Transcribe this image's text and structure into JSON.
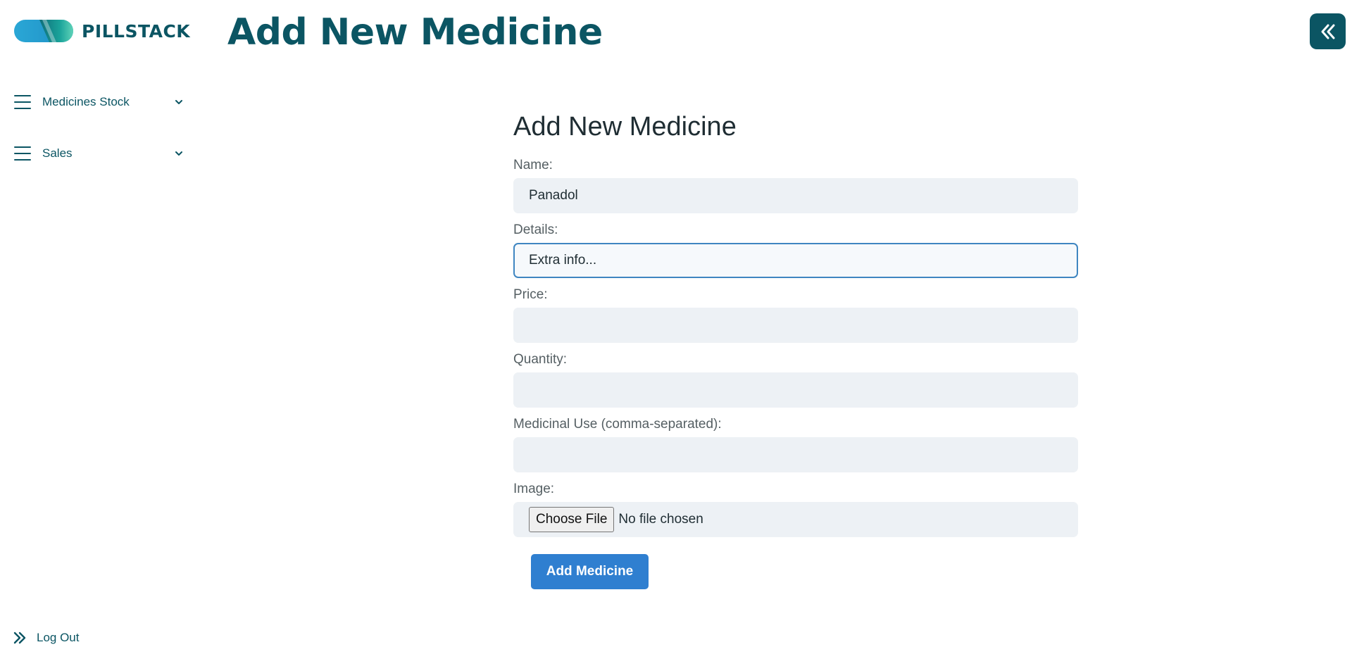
{
  "brand": {
    "name": "PILLSTACK"
  },
  "header": {
    "title": "Add New Medicine"
  },
  "sidebar": {
    "items": [
      {
        "label": "Medicines Stock",
        "icon": "menu-icon"
      },
      {
        "label": "Sales",
        "icon": "menu-icon"
      }
    ],
    "logout_label": "Log Out"
  },
  "form": {
    "title": "Add New Medicine",
    "fields": {
      "name": {
        "label": "Name:",
        "value": "Panadol"
      },
      "details": {
        "label": "Details:",
        "value": "Extra info..."
      },
      "price": {
        "label": "Price:",
        "value": ""
      },
      "quantity": {
        "label": "Quantity:",
        "value": ""
      },
      "medicinal_use": {
        "label": "Medicinal Use (comma-separated):",
        "value": ""
      },
      "image": {
        "label": "Image:",
        "button_label": "Choose File",
        "status": "No file chosen"
      }
    },
    "submit_label": "Add Medicine"
  },
  "colors": {
    "brand": "#0b5563",
    "accent": "#2f7fd0",
    "input_bg": "#edf1f5",
    "focus_border": "#3f86c1"
  }
}
